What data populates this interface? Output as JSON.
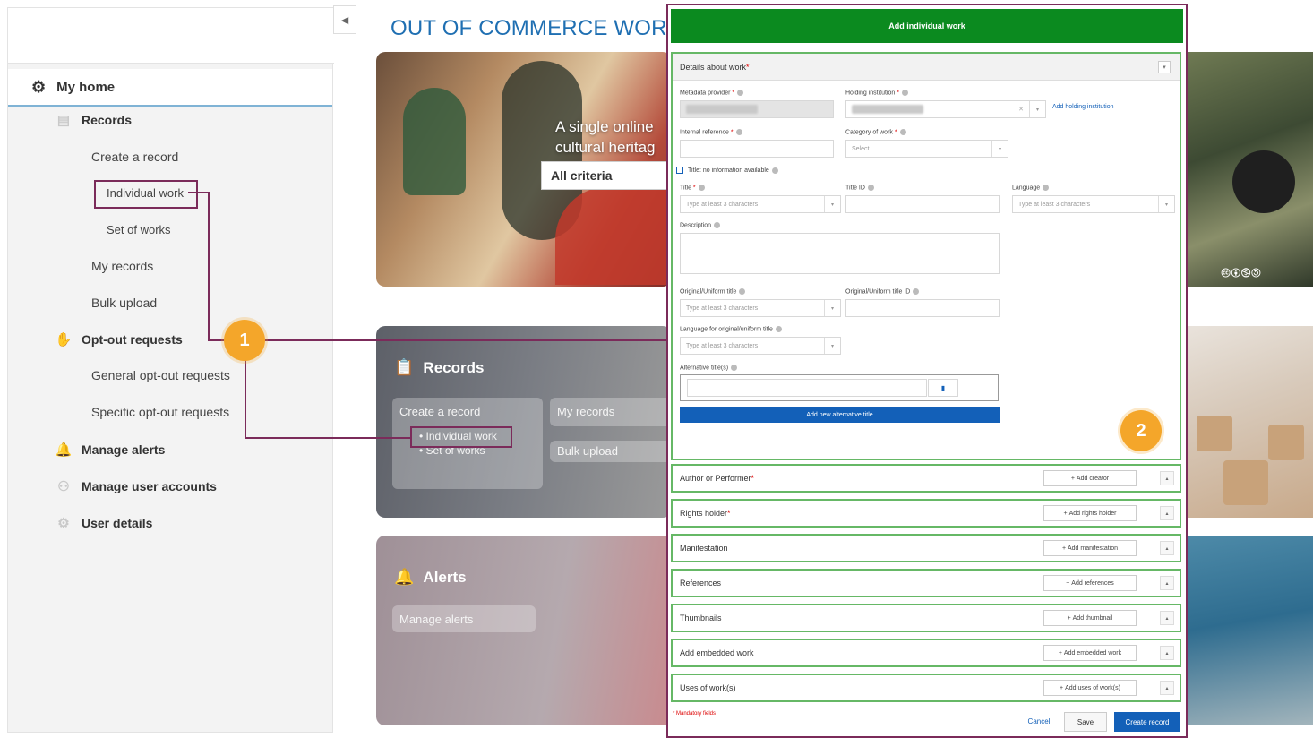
{
  "sidebar": {
    "myhome": "My home",
    "records": "Records",
    "create_record": "Create a record",
    "individual_work": "Individual work",
    "set_of_works": "Set of works",
    "my_records": "My records",
    "bulk_upload": "Bulk upload",
    "optout": "Opt-out requests",
    "general_optout": "General opt-out requests",
    "specific_optout": "Specific opt-out requests",
    "manage_alerts": "Manage alerts",
    "manage_users": "Manage user accounts",
    "user_details": "User details"
  },
  "main": {
    "title": "OUT OF COMMERCE WORKS",
    "hero_line1": "A single online",
    "hero_line2": "cultural heritag",
    "criteria": "All criteria",
    "records_card": {
      "title": "Records",
      "create": "Create a record",
      "individual": "• Individual work",
      "set": "• Set of works",
      "my_records": "My records",
      "bulk": "Bulk upload"
    },
    "alerts_card": {
      "title": "Alerts",
      "manage": "Manage alerts"
    },
    "cc": "🅭🅯🄏🄎"
  },
  "badges": {
    "one": "1",
    "two": "2"
  },
  "modal": {
    "header": "Add individual work",
    "details": "Details about work",
    "metadata_provider": "Metadata provider",
    "holding_institution": "Holding institution",
    "add_holding": "Add holding institution",
    "internal_reference": "Internal reference",
    "category": "Category of work",
    "select": "Select...",
    "no_title": "Title: no information available",
    "title": "Title",
    "title_id": "Title ID",
    "language": "Language",
    "type3": "Type at least 3 characters",
    "description": "Description",
    "original_title": "Original/Uniform title",
    "original_title_id": "Original/Uniform title ID",
    "lang_original": "Language for original/uniform title",
    "alt_titles": "Alternative title(s)",
    "add_alt": "Add new alternative title",
    "sections": [
      {
        "label": "Author or Performer",
        "required": true,
        "btn": "Add creator"
      },
      {
        "label": "Rights holder",
        "required": true,
        "btn": "Add rights holder"
      },
      {
        "label": "Manifestation",
        "required": false,
        "btn": "Add manifestation"
      },
      {
        "label": "References",
        "required": false,
        "btn": "Add references"
      },
      {
        "label": "Thumbnails",
        "required": false,
        "btn": "Add thumbnail"
      },
      {
        "label": "Add embedded work",
        "required": false,
        "btn": "Add embedded work"
      },
      {
        "label": "Uses of work(s)",
        "required": false,
        "btn": "Add uses of work(s)"
      }
    ],
    "mandatory": "* Mandatory fields",
    "cancel": "Cancel",
    "save": "Save",
    "create": "Create record"
  },
  "colors": {
    "accent_green": "#0b8a1f",
    "highlight": "#7b2b5a",
    "badge": "#f4a62a",
    "title_blue": "#1f6fb2",
    "button_blue": "#1360b8"
  }
}
